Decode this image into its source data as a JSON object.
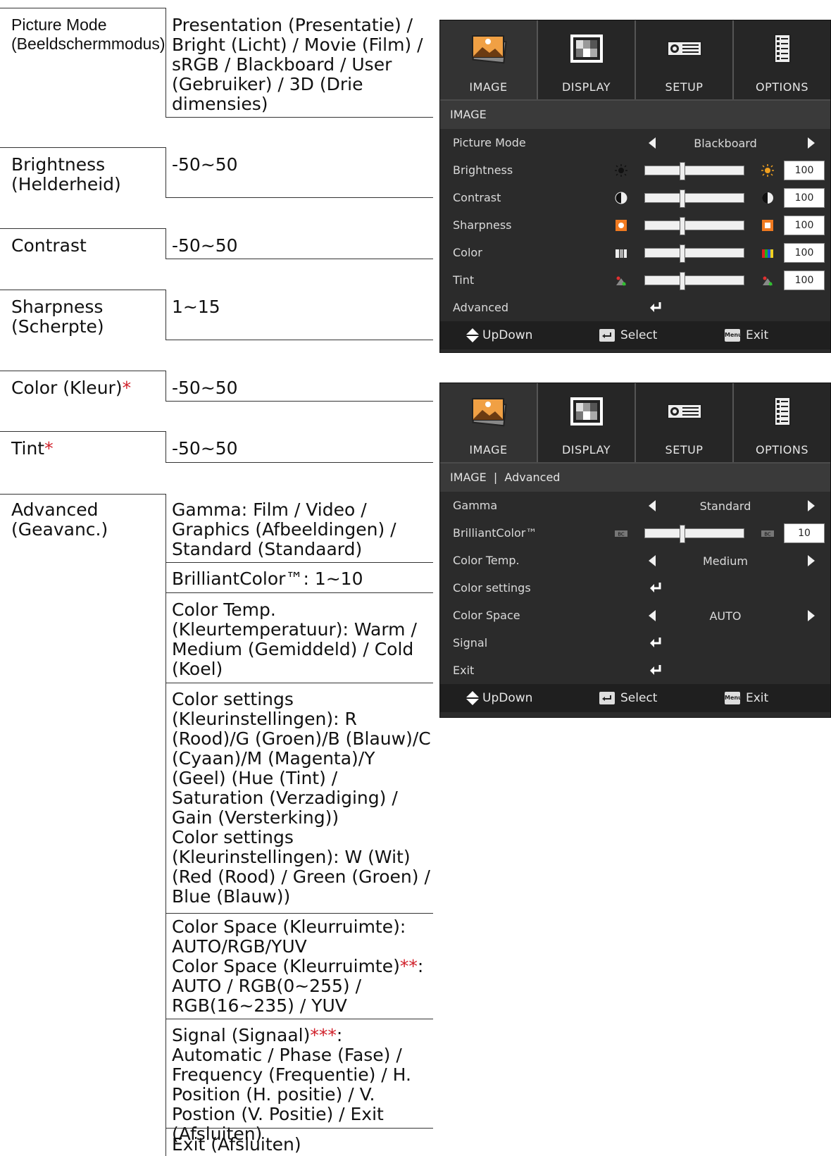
{
  "table": {
    "rows": [
      {
        "label": "Picture Mode\n(Beeldschermmodus)",
        "values": [
          "Presentation (Presentatie) / Bright (Licht) / Movie (Film) / sRGB / Blackboard / User (Gebruiker) / 3D (Drie dimensies)"
        ]
      },
      {
        "label": "Brightness\n(Helderheid)",
        "values": [
          "-50~50"
        ]
      },
      {
        "label": "Contrast",
        "values": [
          "-50~50"
        ]
      },
      {
        "label": "Sharpness\n(Scherpte)",
        "values": [
          "1~15"
        ]
      },
      {
        "label": "Color (Kleur)",
        "label_mark": "*",
        "values": [
          "-50~50"
        ]
      },
      {
        "label": "Tint",
        "label_mark": "*",
        "values": [
          "-50~50"
        ]
      },
      {
        "label": "Advanced\n(Geavanc.)",
        "values": [
          "Gamma: Film / Video / Graphics (Afbeeldingen) / Standard (Standaard)",
          "BrilliantColor™: 1~10",
          "Color Temp. (Kleurtemperatuur): Warm / Medium (Gemiddeld) / Cold (Koel)",
          "Color settings (Kleurinstellingen): R (Rood)/G (Groen)/B (Blauw)/C (Cyaan)/M (Magenta)/Y (Geel) (Hue (Tint) / Saturation (Verzadiging) / Gain (Versterking))",
          "Color settings (Kleurinstellingen): W (Wit) (Red (Rood) / Green (Groen) / Blue (Blauw))",
          "Color Space (Kleurruimte): AUTO/RGB/YUV",
          "Color Space (Kleurruimte)",
          "**",
          ": AUTO / RGB(0~255) / RGB(16~235) / YUV",
          "Signal (Signaal)",
          "***",
          ": Automatic / Phase (Fase) / Frequency (Frequentie) / H. Position (H. positie) / V. Postion (V. Positie) / Exit (Afsluiten)",
          "Exit (Afsluiten)"
        ]
      }
    ]
  },
  "osd1": {
    "tabs": [
      "IMAGE",
      "DISPLAY",
      "SETUP",
      "OPTIONS"
    ],
    "breadcrumb": "IMAGE",
    "picture_mode": {
      "label": "Picture Mode",
      "value": "Blackboard"
    },
    "sliders": [
      {
        "label": "Brightness",
        "value": "100",
        "level": 0.37
      },
      {
        "label": "Contrast",
        "value": "100",
        "level": 0.37
      },
      {
        "label": "Sharpness",
        "value": "100",
        "level": 0.37
      },
      {
        "label": "Color",
        "value": "100",
        "level": 0.37
      },
      {
        "label": "Tint",
        "value": "100",
        "level": 0.37
      }
    ],
    "advanced": "Advanced",
    "footer": {
      "updown": "UpDown",
      "select": "Select",
      "exit": "Exit",
      "menu_key": "Menu"
    }
  },
  "osd2": {
    "tabs": [
      "IMAGE",
      "DISPLAY",
      "SETUP",
      "OPTIONS"
    ],
    "breadcrumb": "IMAGE  |  Advanced",
    "gamma": {
      "label": "Gamma",
      "value": "Standard"
    },
    "brilliantcolor": {
      "label": "BrilliantColor™",
      "value": "10",
      "level": 0.37
    },
    "color_temp": {
      "label": "Color Temp.",
      "value": "Medium"
    },
    "color_settings": "Color settings",
    "color_space": {
      "label": "Color Space",
      "value": "AUTO"
    },
    "signal": "Signal",
    "exit": "Exit",
    "footer": {
      "updown": "UpDown",
      "select": "Select",
      "exit": "Exit",
      "menu_key": "Menu"
    }
  },
  "colors": {
    "asterisk": "#d0202a",
    "osd_bg": "#2b2b2b",
    "osd_header": "#1c1c1c"
  }
}
